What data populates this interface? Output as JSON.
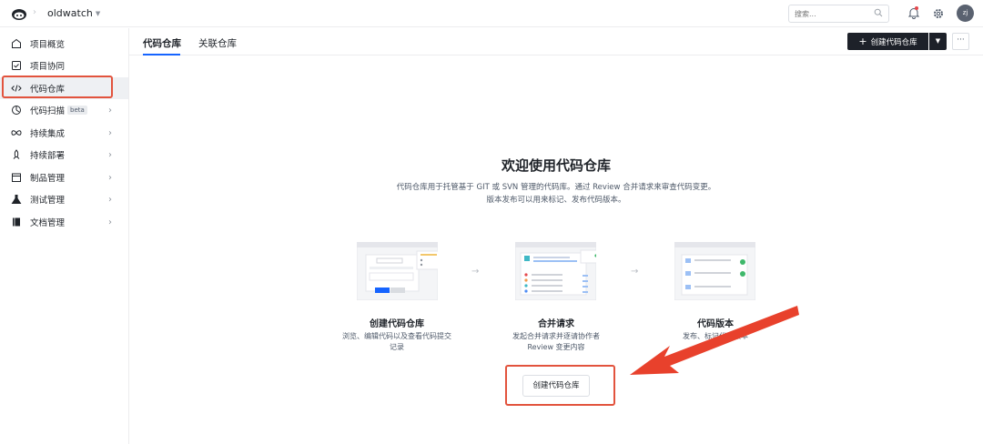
{
  "topbar": {
    "project_name": "oldwatch",
    "search_placeholder": "搜索...",
    "avatar_initials": "zj"
  },
  "sidebar": {
    "items": [
      {
        "label": "项目概览",
        "icon": "home-icon",
        "has_chevron": false
      },
      {
        "label": "项目协同",
        "icon": "checkbox-icon",
        "has_chevron": false
      },
      {
        "label": "代码仓库",
        "icon": "code-icon",
        "has_chevron": false,
        "active": true
      },
      {
        "label": "代码扫描",
        "icon": "scan-icon",
        "has_chevron": true,
        "badge": "beta"
      },
      {
        "label": "持续集成",
        "icon": "infinity-icon",
        "has_chevron": true
      },
      {
        "label": "持续部署",
        "icon": "rocket-icon",
        "has_chevron": true
      },
      {
        "label": "制品管理",
        "icon": "box-icon",
        "has_chevron": true
      },
      {
        "label": "测试管理",
        "icon": "flask-icon",
        "has_chevron": true
      },
      {
        "label": "文档管理",
        "icon": "book-icon",
        "has_chevron": true
      }
    ]
  },
  "tabs": [
    {
      "label": "代码仓库",
      "active": true
    },
    {
      "label": "关联仓库",
      "active": false
    }
  ],
  "toolbar": {
    "create_label": "创建代码仓库",
    "more_label": "···"
  },
  "welcome": {
    "title": "欢迎使用代码仓库",
    "desc_line1": "代码仓库用于托管基于 GIT 或 SVN 管理的代码库。通过 Review 合并请求来审查代码变更。",
    "desc_line2": "版本发布可以用来标记、发布代码版本。"
  },
  "features": [
    {
      "title": "创建代码仓库",
      "desc_line1": "浏览、编辑代码以及查看代码提交",
      "desc_line2": "记录"
    },
    {
      "title": "合并请求",
      "desc_line1": "发起合并请求并逐请协作者",
      "desc_line2": "Review 变更内容"
    },
    {
      "title": "代码版本",
      "desc_line1": "发布、标记代码版本",
      "desc_line2": ""
    }
  ],
  "cta": {
    "label": "创建代码仓库"
  },
  "colors": {
    "accent": "#1664ff",
    "highlight": "#e2533d",
    "dark_button": "#1d2129"
  }
}
